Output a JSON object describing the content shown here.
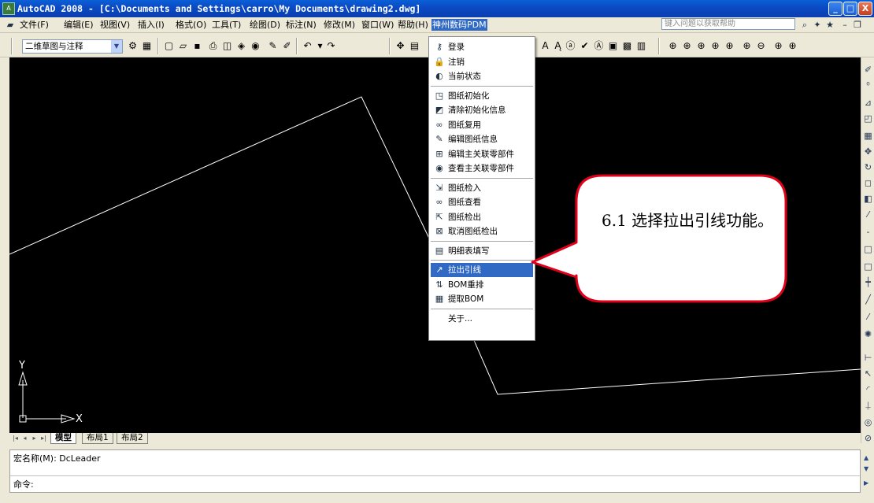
{
  "window": {
    "title": "AutoCAD 2008 - [C:\\Documents and Settings\\carro\\My Documents\\drawing2.dwg]",
    "app_icon_text": "A",
    "min_label": "_",
    "max_label": "□",
    "close_label": "X"
  },
  "menubar": {
    "items": [
      "文件(F)",
      "编辑(E)",
      "视图(V)",
      "插入(I)",
      "格式(O)",
      "工具(T)",
      "绘图(D)",
      "标注(N)",
      "修改(M)",
      "窗口(W)",
      "帮助(H)",
      "神州数码PDM"
    ],
    "help_placeholder": "键入问题以获取帮助"
  },
  "toolbar": {
    "workspace_value": "二维草图与注释"
  },
  "dropdown": {
    "groups": [
      [
        {
          "label": "登录",
          "icon": "key-icon"
        },
        {
          "label": "注销",
          "icon": "lock-icon"
        },
        {
          "label": "当前状态",
          "icon": "status-icon"
        }
      ],
      [
        {
          "label": "图纸初始化",
          "icon": "drawing-init-icon"
        },
        {
          "label": "清除初始化信息",
          "icon": "clear-icon"
        },
        {
          "label": "图纸复用",
          "icon": "reuse-icon"
        },
        {
          "label": "编辑图纸信息",
          "icon": "edit-icon"
        },
        {
          "label": "编辑主关联零部件",
          "icon": "parts-icon"
        },
        {
          "label": "查看主关联零部件",
          "icon": "view-parts-icon"
        }
      ],
      [
        {
          "label": "图纸检入",
          "icon": "checkin-icon"
        },
        {
          "label": "图纸查看",
          "icon": "glasses-icon"
        },
        {
          "label": "图纸检出",
          "icon": "checkout-icon"
        },
        {
          "label": "取消图纸检出",
          "icon": "cancel-checkout-icon"
        }
      ],
      [
        {
          "label": "明细表填写",
          "icon": "table-icon"
        }
      ],
      [
        {
          "label": "拉出引线",
          "icon": "leader-icon",
          "highlighted": true
        },
        {
          "label": "BOM重排",
          "icon": "bom-sort-icon"
        },
        {
          "label": "提取BOM",
          "icon": "bom-extract-icon"
        }
      ],
      [
        {
          "label": "关于...",
          "icon": ""
        }
      ]
    ]
  },
  "tabs": [
    "模型",
    "布局1",
    "布局2"
  ],
  "ucs": {
    "y_label": "Y",
    "x_label": "X"
  },
  "command": {
    "line1": "宏名称(M): DcLeader",
    "line2": "命令:"
  },
  "callout": {
    "text": "6.1  选择拉出引线功能。",
    "border_color": "#e0001a"
  },
  "colors": {
    "titlebar": "#0b49c2",
    "highlight": "#316ac5",
    "canvas": "#000000"
  }
}
